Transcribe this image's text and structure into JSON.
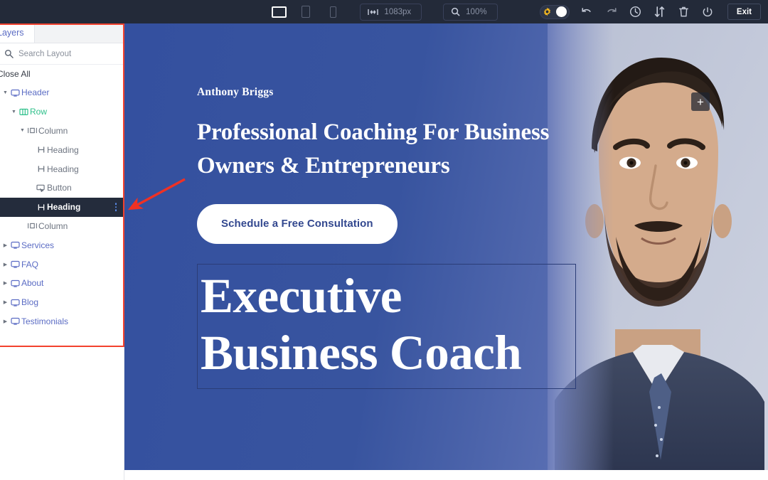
{
  "toolbar": {
    "devices": [
      {
        "name": "desktop",
        "label": "Desktop",
        "active": true
      },
      {
        "name": "tablet",
        "label": "Tablet",
        "active": false
      },
      {
        "name": "mobile",
        "label": "Mobile",
        "active": false
      }
    ],
    "width_value": "1083px",
    "zoom_value": "100%",
    "theme_toggle": {
      "icon": "gear-icon",
      "state": "on"
    },
    "actions": [
      {
        "name": "undo",
        "label": "Undo"
      },
      {
        "name": "redo",
        "label": "Redo"
      },
      {
        "name": "history",
        "label": "History"
      },
      {
        "name": "revisions",
        "label": "Revisions"
      },
      {
        "name": "trash",
        "label": "Delete"
      },
      {
        "name": "power",
        "label": "Power"
      }
    ],
    "exit_label": "Exit",
    "bg_color": "#232a39"
  },
  "panel": {
    "tab_label": "Layers",
    "search_placeholder": "Search Layout",
    "search_value": "",
    "close_all_label": "Close All",
    "highlight_color": "#f2422e",
    "tree": [
      {
        "label": "Header",
        "icon": "module-icon",
        "level": 0,
        "caret": "open",
        "color": "blue",
        "selected": false
      },
      {
        "label": "Row",
        "icon": "row-icon",
        "level": 1,
        "caret": "open",
        "color": "green",
        "selected": false
      },
      {
        "label": "Column",
        "icon": "column-icon",
        "level": 2,
        "caret": "open",
        "color": "grey",
        "selected": false
      },
      {
        "label": "Heading",
        "icon": "heading-icon",
        "level": 3,
        "caret": "none",
        "color": "grey",
        "selected": false
      },
      {
        "label": "Heading",
        "icon": "heading-icon",
        "level": 3,
        "caret": "none",
        "color": "grey",
        "selected": false
      },
      {
        "label": "Button",
        "icon": "button-icon",
        "level": 3,
        "caret": "none",
        "color": "grey",
        "selected": false
      },
      {
        "label": "Heading",
        "icon": "heading-icon",
        "level": 3,
        "caret": "none",
        "color": "grey",
        "selected": true
      },
      {
        "label": "Column",
        "icon": "column-icon",
        "level": 2,
        "caret": "none",
        "color": "grey",
        "selected": false
      },
      {
        "label": "Services",
        "icon": "module-icon",
        "level": 0,
        "caret": "closed",
        "color": "blue",
        "selected": false
      },
      {
        "label": "FAQ",
        "icon": "module-icon",
        "level": 0,
        "caret": "closed",
        "color": "blue",
        "selected": false
      },
      {
        "label": "About",
        "icon": "module-icon",
        "level": 0,
        "caret": "closed",
        "color": "blue",
        "selected": false
      },
      {
        "label": "Blog",
        "icon": "module-icon",
        "level": 0,
        "caret": "closed",
        "color": "blue",
        "selected": false
      },
      {
        "label": "Testimonials",
        "icon": "module-icon",
        "level": 0,
        "caret": "closed",
        "color": "blue",
        "selected": false
      }
    ]
  },
  "canvas": {
    "hero": {
      "eyebrow": "Anthony Briggs",
      "headline_line1": "Professional Coaching For Business",
      "headline_line2": "Owners & Entrepreneurs",
      "cta_label": "Schedule a Free Consultation",
      "selected_heading_line1": "Executive",
      "selected_heading_line2": "Business Coach",
      "add_button_label": "+",
      "bg_color": "#34509f",
      "text_color": "#ffffff",
      "cta_text_color": "#33488f"
    }
  }
}
